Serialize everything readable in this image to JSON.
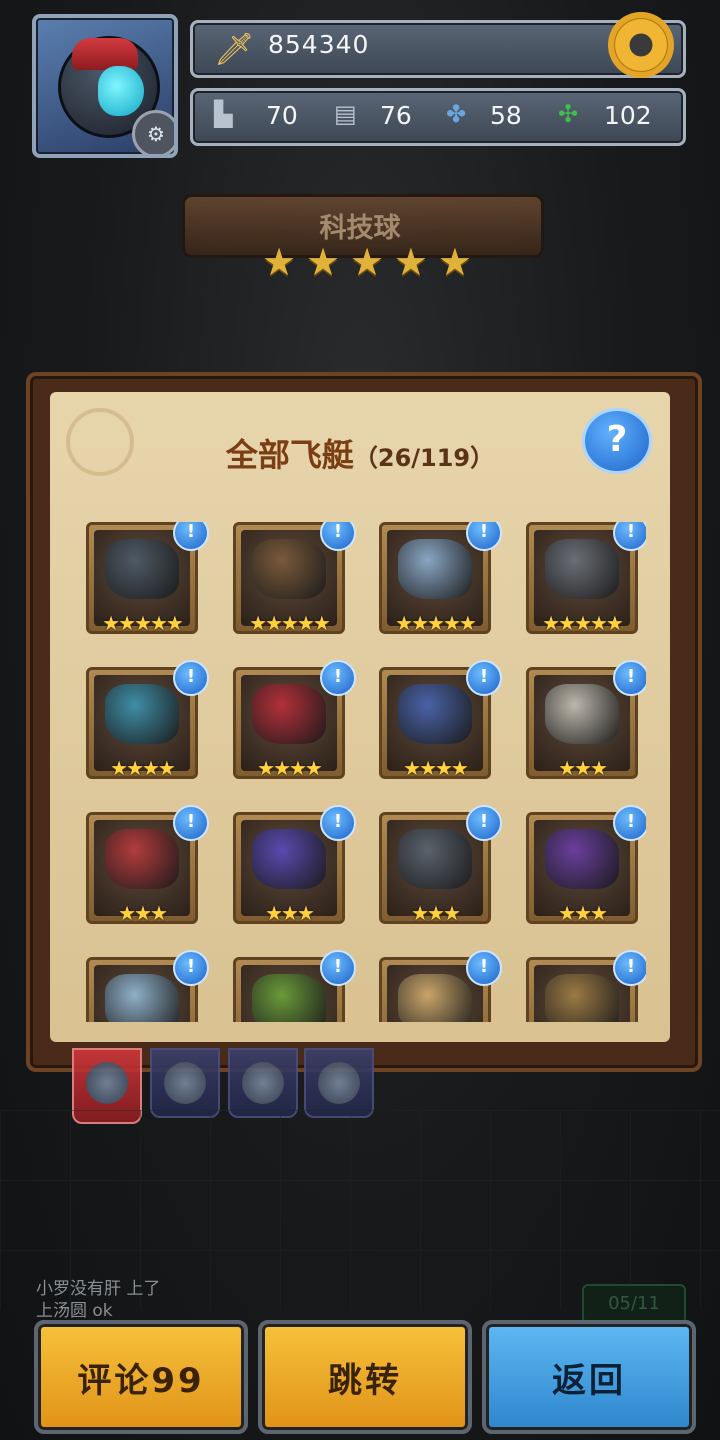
{
  "header": {
    "power_value": "854340",
    "resources": [
      {
        "icon": "tank-icon",
        "value": "70"
      },
      {
        "icon": "chip-icon",
        "value": "76"
      },
      {
        "icon": "fan-icon",
        "value": "58"
      },
      {
        "icon": "clover-icon",
        "value": "102"
      }
    ]
  },
  "banner": {
    "title": "科技球",
    "stars": 5
  },
  "panel": {
    "title": "全部飞艇",
    "count": "（26/119）",
    "help_symbol": "?"
  },
  "ships": [
    {
      "stars": 5,
      "color": "#4e5a66"
    },
    {
      "stars": 5,
      "color": "#7a5a3a"
    },
    {
      "stars": 5,
      "color": "#8aa6c4"
    },
    {
      "stars": 5,
      "color": "#6b6f76"
    },
    {
      "stars": 4,
      "color": "#3f8ea6"
    },
    {
      "stars": 4,
      "color": "#b3303a"
    },
    {
      "stars": 4,
      "color": "#4a63a8"
    },
    {
      "stars": 3,
      "color": "#bdb7ab"
    },
    {
      "stars": 3,
      "color": "#b33c3c"
    },
    {
      "stars": 3,
      "color": "#5a4ab0"
    },
    {
      "stars": 3,
      "color": "#5a626c"
    },
    {
      "stars": 3,
      "color": "#6a3f9e"
    },
    {
      "stars": 0,
      "color": "#8fb0c8"
    },
    {
      "stars": 0,
      "color": "#6a9a3a"
    },
    {
      "stars": 0,
      "color": "#c9a56a"
    },
    {
      "stars": 0,
      "color": "#9b7a44"
    }
  ],
  "alert_symbol": "!",
  "star_glyph": "★",
  "chat": {
    "line1": "小罗没有肝 上了",
    "line2": "上汤圆 ok"
  },
  "timer": "05/11",
  "buttons": {
    "comment": "评论99",
    "jump": "跳转",
    "back": "返回"
  }
}
